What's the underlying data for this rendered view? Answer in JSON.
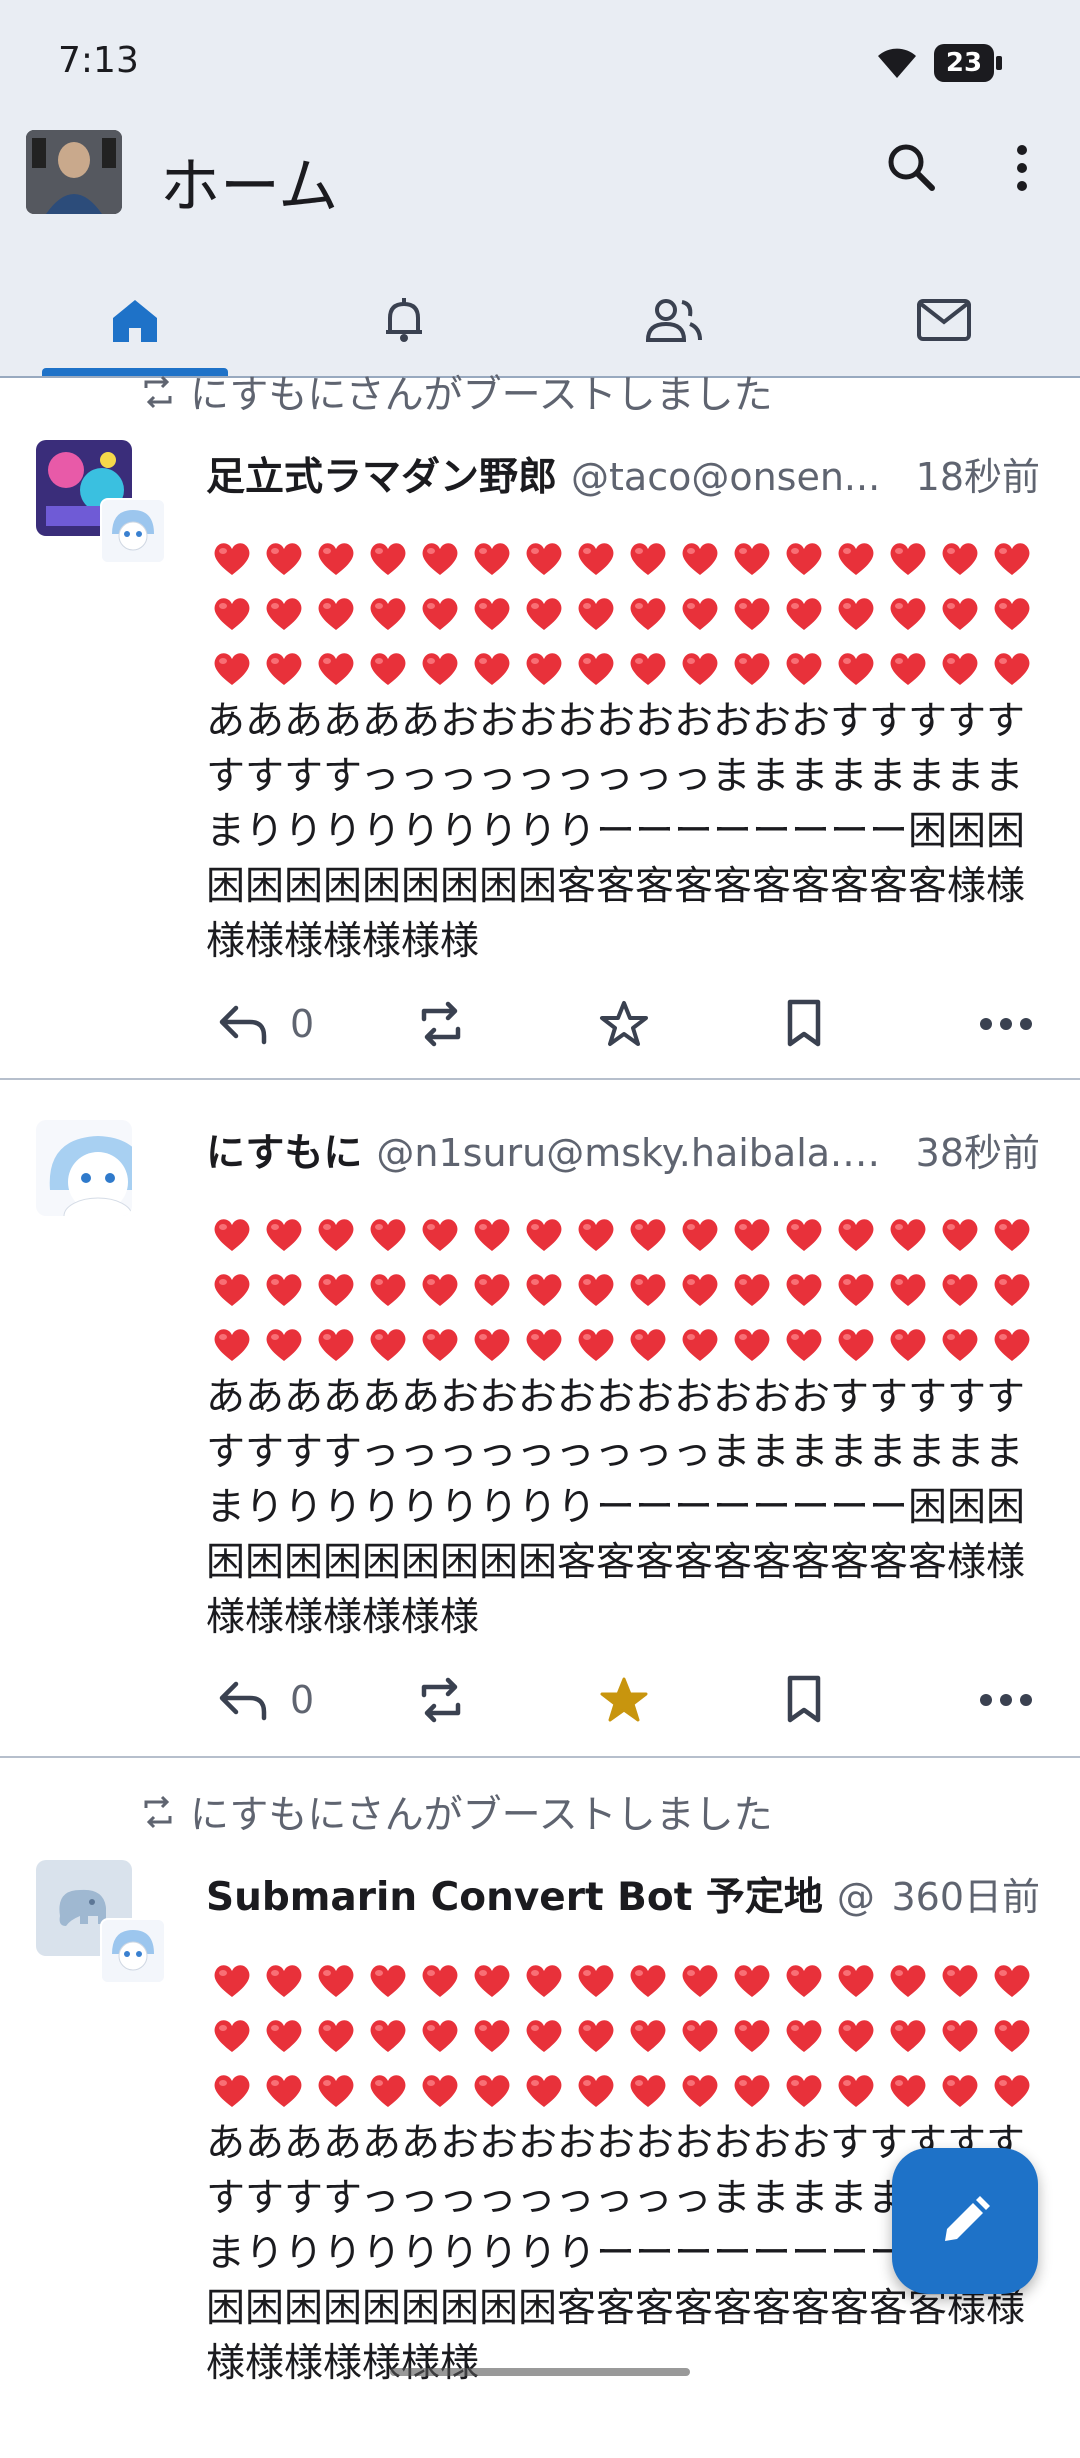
{
  "status_bar": {
    "time": "7:13",
    "battery": "23"
  },
  "app_bar": {
    "title": "ホーム"
  },
  "tabs": [
    {
      "name": "home",
      "icon": "home-icon",
      "active": true
    },
    {
      "name": "notifications",
      "icon": "bell-icon",
      "active": false
    },
    {
      "name": "social",
      "icon": "people-icon",
      "active": false
    },
    {
      "name": "messages",
      "icon": "mail-icon",
      "active": false
    }
  ],
  "posts": [
    {
      "boost_label": "にすもにさんがブーストしました",
      "display_name": "足立式ラマダン野郎",
      "account": "@taco@onsen...",
      "time": "18秒前",
      "heart_rows": 3,
      "text": "ああああああおおおおおおおおおおすすすすすすすすすっっっっっっっっっまままままままままりりりりりりりりりーーーーーーーー困困困困困困困困困困困困客客客客客客客客客客様様様様様様様様様",
      "reply_count": "0",
      "favourited": false
    },
    {
      "boost_label": "",
      "display_name": "にすもに",
      "account": "@n1suru@msky.haibala.c...",
      "time": "38秒前",
      "heart_rows": 3,
      "text": "ああああああおおおおおおおおおおすすすすすすすすすっっっっっっっっっまままままままままりりりりりりりりりーーーーーーーー困困困困困困困困困困困困客客客客客客客客客客様様様様様様様様様",
      "reply_count": "0",
      "favourited": true
    },
    {
      "boost_label": "にすもにさんがブーストしました",
      "display_name": "Submarin Convert Bot 予定地",
      "account": "@s...",
      "time": "360日前",
      "heart_rows": 3,
      "text": "ああああああおおおおおおおおおおすすすすすすすすすっっっっっっっっっまままままままままりりりりりりりりりーーーーーーーー困困困困困困困困困困困困客客客客客客客客客客様様様様様様様様様",
      "reply_count": "",
      "favourited": false
    }
  ],
  "colors": {
    "accent": "#1e72c8",
    "heart": "#e8313a",
    "star_active": "#c8950e",
    "bar_bg": "#e9edf3"
  }
}
